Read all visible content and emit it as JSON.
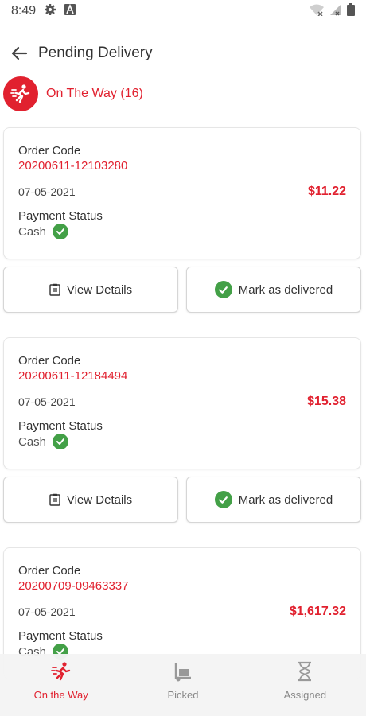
{
  "status_bar": {
    "time": "8:49"
  },
  "header": {
    "title": "Pending Delivery"
  },
  "section": {
    "title": "On The Way (16)"
  },
  "orders": [
    {
      "code_label": "Order Code",
      "code": "20200611-12103280",
      "date": "07-05-2021",
      "amount": "$11.22",
      "payment_label": "Payment Status",
      "payment_value": "Cash"
    },
    {
      "code_label": "Order Code",
      "code": "20200611-12184494",
      "date": "07-05-2021",
      "amount": "$15.38",
      "payment_label": "Payment Status",
      "payment_value": "Cash"
    },
    {
      "code_label": "Order Code",
      "code": "20200709-09463337",
      "date": "07-05-2021",
      "amount": "$1,617.32",
      "payment_label": "Payment Status",
      "payment_value": "Cash"
    }
  ],
  "actions": {
    "view_details": "View Details",
    "mark_delivered": "Mark as delivered"
  },
  "bottom_nav": [
    {
      "label": "On the Way",
      "icon": "running-person-icon",
      "active": true
    },
    {
      "label": "Picked",
      "icon": "hand-truck-icon",
      "active": false
    },
    {
      "label": "Assigned",
      "icon": "hourglass-icon",
      "active": false
    }
  ],
  "colors": {
    "accent": "#e1212f",
    "success": "#43a047"
  }
}
